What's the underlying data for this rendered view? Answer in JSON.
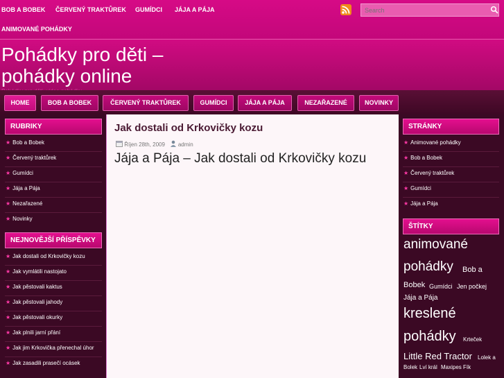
{
  "top_menu": [
    "BOB A BOBEK",
    "ČERVENÝ TRAKTŮREK",
    "GUMÍDCI",
    "JÁJA A PÁJA",
    "ANIMOVANÉ POHÁDKY"
  ],
  "search": {
    "placeholder": "Search"
  },
  "header": {
    "title": "Pohádky pro děti – pohádky online",
    "tagline": "Pohádky pro děti, video pohádky"
  },
  "nav": [
    "HOME",
    "BOB A BOBEK",
    "ČERVENÝ TRAKTŮREK",
    "GUMÍDCI",
    "JÁJA A PÁJA",
    "NEZAŘAZENÉ",
    "NOVINKY"
  ],
  "rubriky": {
    "title": "RUBRIKY",
    "items": [
      "Bob a Bobek",
      "Červený traktůrek",
      "Gumídci",
      "Jája a Pája",
      "Nezařazené",
      "Novinky"
    ]
  },
  "recent": {
    "title": "NEJNOVĚJŠÍ PŘÍSPĚVKY",
    "items": [
      "Jak dostali od Krkovičky kozu",
      "Jak vymlátili nastojato",
      "Jak pěstovali kaktus",
      "Jak pěstovali jahody",
      "Jak pěstovali okurky",
      "Jak plnili jarní přání",
      "Jak jim Krkovička přenechal úhor",
      "Jak zasadili prasečí ocásek"
    ]
  },
  "post": {
    "title": "Jak dostali od Krkovičky kozu",
    "date": "Říjen 28th, 2009",
    "author": "admin",
    "body": "Jája a Pája – Jak dostali od Krkovičky kozu"
  },
  "stranky": {
    "title": "STRÁNKY",
    "items": [
      "Animované pohádky",
      "Bob a Bobek",
      "Červený traktůrek",
      "Gumídci",
      "Jája a Pája"
    ]
  },
  "stitky": {
    "title": "ŠTÍTKY",
    "tags": [
      "animované",
      "pohádky",
      "Bob a",
      "Bobek",
      "Gumídci",
      "Jen počkej",
      "Jája a Pája",
      "kreslené",
      "pohádky",
      "Krteček",
      "Little Red Tractor",
      "Lolek a",
      "Bolek",
      "Lví král",
      "Maxipes Fík"
    ]
  },
  "colors": {
    "accent": "#d60a86",
    "dark": "#3b0924",
    "star": "#ff3aa8"
  }
}
